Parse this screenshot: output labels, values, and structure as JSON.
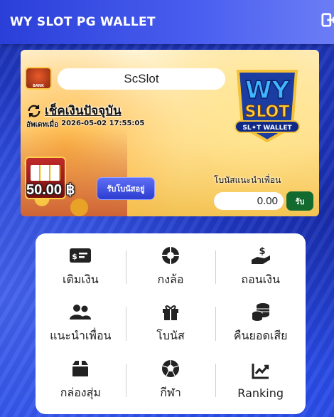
{
  "header": {
    "title": "WY SLOT PG WALLET",
    "logout_icon": "logout-icon"
  },
  "banner": {
    "site_name": "ScSlot",
    "check_balance_label": "เช็คเงินปัจจุบัน",
    "updated_label": "อัพเดทเมื่อ",
    "updated_time": "2026-05-02 17:55:05",
    "balance": "50.00 ฿",
    "bonus_button": "รับโบนัสอยู่",
    "referral_label": "โบนัสแนะนำเพื่อน",
    "referral_amount": "0.00",
    "referral_button": "รับ",
    "logo_text_top": "WY",
    "logo_text_mid": "SLOT",
    "logo_text_bottom": "SL✦T WALLET"
  },
  "menu": {
    "items": [
      {
        "label": "เติมเงิน",
        "icon": "deposit-icon"
      },
      {
        "label": "กงล้อ",
        "icon": "wheel-icon"
      },
      {
        "label": "ถอนเงิน",
        "icon": "withdraw-icon"
      },
      {
        "label": "แนะนำเพื่อน",
        "icon": "users-icon"
      },
      {
        "label": "โบนัส",
        "icon": "gift-icon"
      },
      {
        "label": "คืนยอดเสีย",
        "icon": "coins-icon"
      },
      {
        "label": "กล่องสุ่ม",
        "icon": "box-icon"
      },
      {
        "label": "กีฬา",
        "icon": "soccer-icon"
      },
      {
        "label": "Ranking",
        "icon": "chart-icon"
      }
    ]
  },
  "colors": {
    "header_start": "#2a3fd8",
    "background": "#2441d6",
    "referral_button": "#126a2e",
    "bonus_button": "#3a4be0"
  }
}
